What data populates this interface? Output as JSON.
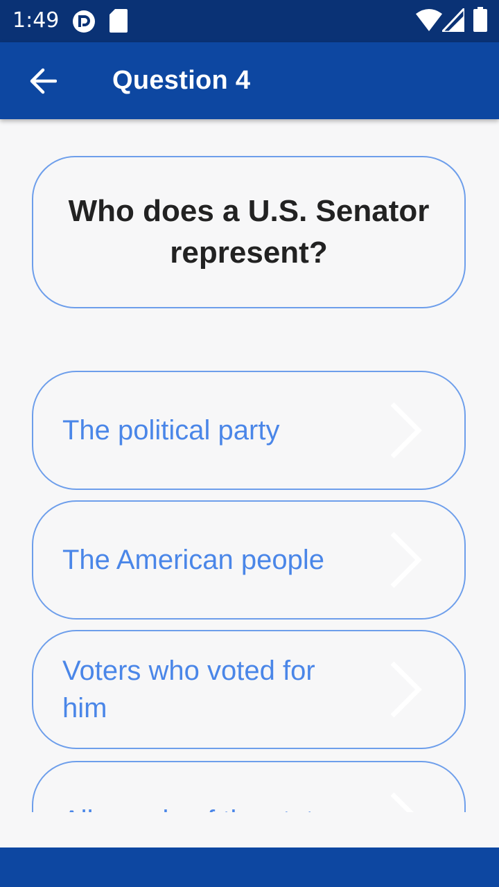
{
  "status_bar": {
    "time": "1:49",
    "icons": [
      "app-notification-icon",
      "sd-card-icon",
      "wifi-icon",
      "cell-signal-icon",
      "battery-icon"
    ]
  },
  "app_bar": {
    "title": "Question 4",
    "back_icon": "arrow-back-icon"
  },
  "question": {
    "text": "Who does a U.S. Senator represent?"
  },
  "answers": [
    {
      "label": "The political party"
    },
    {
      "label": "The American people"
    },
    {
      "label": "Voters who voted for him"
    },
    {
      "label": "All people of the state"
    }
  ],
  "colors": {
    "status_bar": "#0a3275",
    "app_bar": "#0d47a1",
    "card_border": "#6d9eeb",
    "answer_text": "#4a86e8",
    "background": "#f7f7f8"
  }
}
